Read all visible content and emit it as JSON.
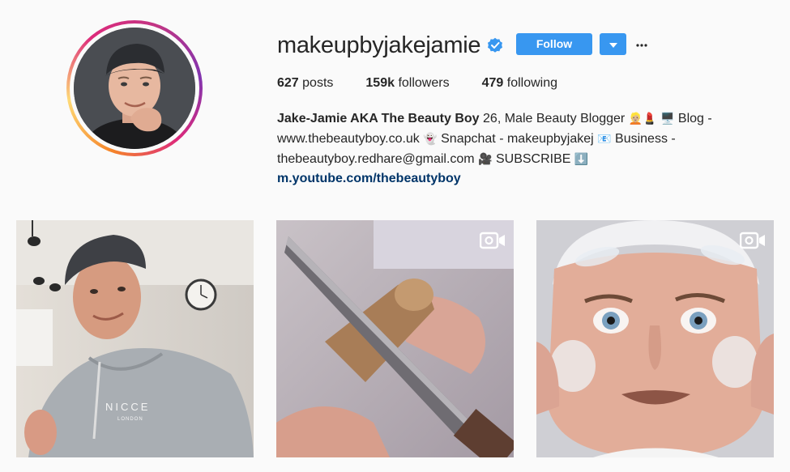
{
  "profile": {
    "username": "makeupbyjakejamie",
    "verified": true
  },
  "actions": {
    "follow_label": "Follow",
    "dropdown_icon": "chevron-down-icon",
    "more_icon": "more-options-icon"
  },
  "stats": {
    "posts_count": "627",
    "posts_label": "posts",
    "followers_count": "159k",
    "followers_label": "followers",
    "following_count": "479",
    "following_label": "following"
  },
  "bio": {
    "name": "Jake-Jamie AKA The Beauty Boy",
    "part1": " 26, Male Beauty Blogger ",
    "emoji1": "👱🏼💄",
    "part2": " ",
    "emoji2": "🖥️",
    "part3": " Blog - www.thebeautyboy.co.uk ",
    "emoji3": "👻",
    "part4": " Snapchat - makeupbyjakej ",
    "emoji4": "📧",
    "part5": " Business - thebeautyboy.redhare@gmail.com ",
    "emoji5": "🎥",
    "part6": " SUBSCRIBE ",
    "emoji6": "⬇️",
    "link": "m.youtube.com/thebeautyboy"
  },
  "posts": [
    {
      "type": "photo",
      "subject": "selfie in grey NICCE hoodie",
      "hoodie_text": "NICCE",
      "hoodie_sub": "LONDON"
    },
    {
      "type": "video",
      "subject": "knife cutting a caramel candy"
    },
    {
      "type": "video",
      "subject": "face with suction cups"
    }
  ],
  "colors": {
    "accent": "#3897f0",
    "link": "#003569",
    "text": "#262626",
    "background": "#fafafa"
  }
}
